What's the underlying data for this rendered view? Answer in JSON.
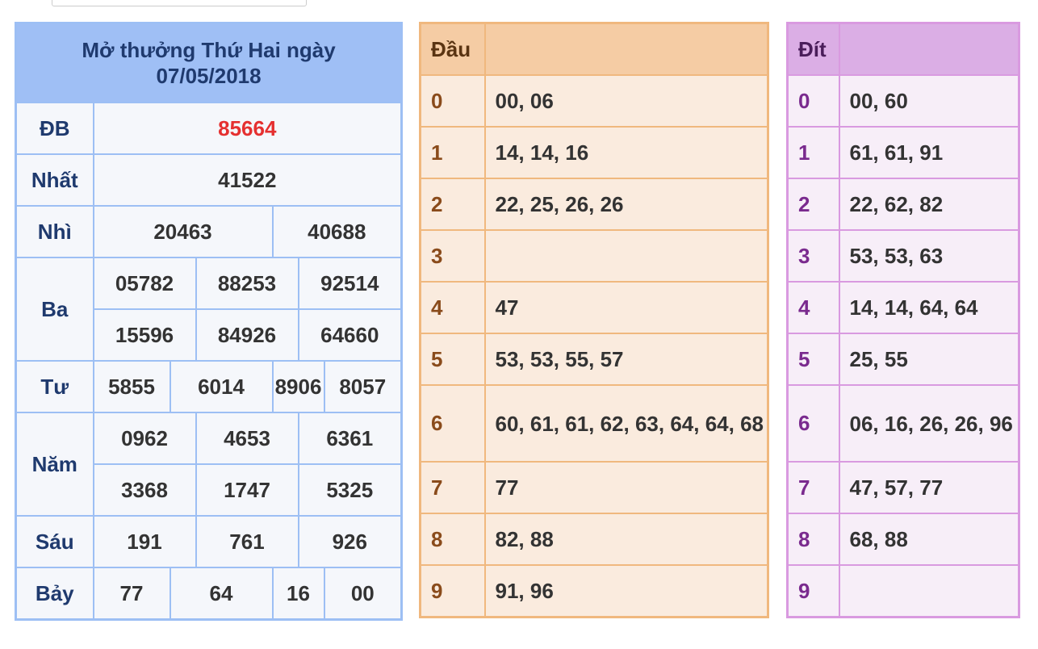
{
  "results": {
    "title_line1": "Mở thưởng Thứ Hai ngày",
    "title_line2": "07/05/2018",
    "db": {
      "label": "ĐB",
      "value": "85664"
    },
    "nhat": {
      "label": "Nhất",
      "value": "41522"
    },
    "nhi": {
      "label": "Nhì",
      "values": [
        "20463",
        "40688"
      ]
    },
    "ba": {
      "label": "Ba",
      "values": [
        "05782",
        "88253",
        "92514",
        "15596",
        "84926",
        "64660"
      ]
    },
    "tu": {
      "label": "Tư",
      "values": [
        "5855",
        "6014",
        "8906",
        "8057"
      ]
    },
    "nam": {
      "label": "Năm",
      "values": [
        "0962",
        "4653",
        "6361",
        "3368",
        "1747",
        "5325"
      ]
    },
    "sau": {
      "label": "Sáu",
      "values": [
        "191",
        "761",
        "926"
      ]
    },
    "bay": {
      "label": "Bảy",
      "values": [
        "77",
        "64",
        "16",
        "00"
      ]
    }
  },
  "dau": {
    "header": "Đầu",
    "rows": [
      {
        "key": "0",
        "value": "00, 06"
      },
      {
        "key": "1",
        "value": "14, 14, 16"
      },
      {
        "key": "2",
        "value": "22, 25, 26, 26"
      },
      {
        "key": "3",
        "value": ""
      },
      {
        "key": "4",
        "value": "47"
      },
      {
        "key": "5",
        "value": "53, 53, 55, 57"
      },
      {
        "key": "6",
        "value": "60, 61, 61, 62, 63, 64, 64, 68"
      },
      {
        "key": "7",
        "value": "77"
      },
      {
        "key": "8",
        "value": "82, 88"
      },
      {
        "key": "9",
        "value": "91, 96"
      }
    ]
  },
  "dit": {
    "header": "Đít",
    "rows": [
      {
        "key": "0",
        "value": "00, 60"
      },
      {
        "key": "1",
        "value": "61, 61, 91"
      },
      {
        "key": "2",
        "value": "22, 62, 82"
      },
      {
        "key": "3",
        "value": "53, 53, 63"
      },
      {
        "key": "4",
        "value": "14, 14, 64, 64"
      },
      {
        "key": "5",
        "value": "25, 55"
      },
      {
        "key": "6",
        "value": "06, 16, 26, 26, 96"
      },
      {
        "key": "7",
        "value": "47, 57, 77"
      },
      {
        "key": "8",
        "value": "68, 88"
      },
      {
        "key": "9",
        "value": ""
      }
    ]
  }
}
